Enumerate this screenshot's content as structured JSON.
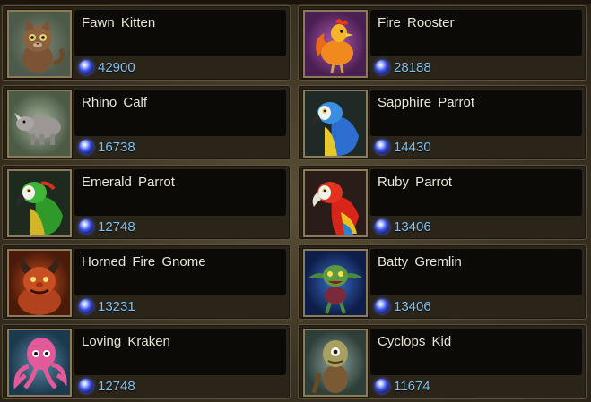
{
  "currency_icon": "blue-gem-icon",
  "colors": {
    "name_text": "#ece6d6",
    "price_text": "#7fc2f2",
    "card_border": "#5b513c"
  },
  "pets": [
    {
      "name": "Fawn Kitten",
      "price": "42900",
      "portrait": "fawn-kitten-portrait"
    },
    {
      "name": "Fire Rooster",
      "price": "28188",
      "portrait": "fire-rooster-portrait"
    },
    {
      "name": "Rhino Calf",
      "price": "16738",
      "portrait": "rhino-calf-portrait"
    },
    {
      "name": "Sapphire Parrot",
      "price": "14430",
      "portrait": "sapphire-parrot-portrait"
    },
    {
      "name": "Emerald Parrot",
      "price": "12748",
      "portrait": "emerald-parrot-portrait"
    },
    {
      "name": "Ruby Parrot",
      "price": "13406",
      "portrait": "ruby-parrot-portrait"
    },
    {
      "name": "Horned Fire Gnome",
      "price": "13231",
      "portrait": "horned-fire-gnome-portrait"
    },
    {
      "name": "Batty Gremlin",
      "price": "13406",
      "portrait": "batty-gremlin-portrait"
    },
    {
      "name": "Loving Kraken",
      "price": "12748",
      "portrait": "loving-kraken-portrait"
    },
    {
      "name": "Cyclops Kid",
      "price": "11674",
      "portrait": "cyclops-kid-portrait"
    }
  ]
}
